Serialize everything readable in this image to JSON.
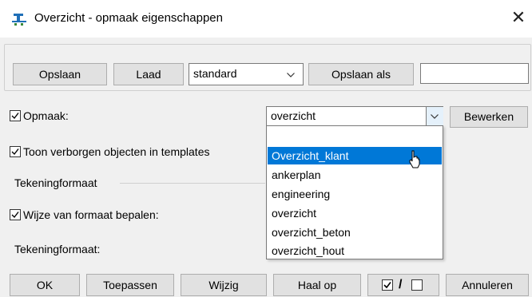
{
  "window": {
    "title": "Overzicht - opmaak eigenschappen"
  },
  "toolbar": {
    "save_label": "Opslaan",
    "load_label": "Laad",
    "preset_value": "standard",
    "save_as_label": "Opslaan als",
    "save_as_name": ""
  },
  "opmaak": {
    "label": "Opmaak:",
    "checked": true,
    "value": "overzicht",
    "edit_label": "Bewerken"
  },
  "dropdown": {
    "blank_item": "",
    "items": [
      "Overzicht_klant",
      "ankerplan",
      "engineering",
      "overzicht",
      "overzicht_beton",
      "overzicht_hout"
    ],
    "highlighted": "Overzicht_klant"
  },
  "options": {
    "show_hidden_label": "Toon verborgen objecten in templates",
    "show_hidden_checked": true,
    "group_title": "Tekeningformaat",
    "determine_label": "Wijze van formaat bepalen:",
    "determine_checked": true,
    "format_label": "Tekeningformaat:"
  },
  "footer": {
    "ok": "OK",
    "apply": "Toepassen",
    "modify": "Wijzig",
    "fetch": "Haal op",
    "toggle_separator": "/",
    "cancel": "Annuleren"
  },
  "colors": {
    "highlight": "#0078d7",
    "button_bg": "#e1e1e1",
    "dialog_bg": "#f0f0f0"
  }
}
